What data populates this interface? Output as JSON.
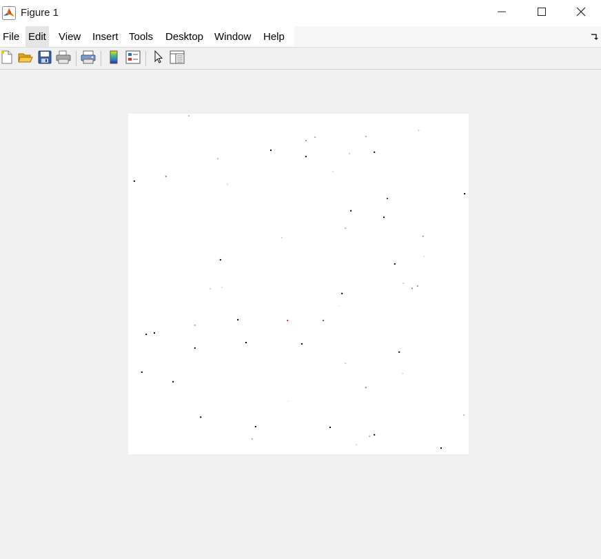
{
  "window": {
    "title": "Figure 1",
    "app_icon": "matlab-icon",
    "controls": [
      "minimize-icon",
      "maximize-icon",
      "close-icon"
    ]
  },
  "menu": {
    "items": [
      "File",
      "Edit",
      "View",
      "Insert",
      "Tools",
      "Desktop",
      "Window",
      "Help"
    ],
    "dock_icon": "dock-figure-icon"
  },
  "toolbar": {
    "buttons": [
      "new-figure-icon",
      "open-file-icon",
      "save-figure-icon",
      "print-figure-icon",
      "link-plot-icon",
      "insert-colorbar-icon",
      "insert-legend-icon",
      "edit-plot-icon",
      "open-property-inspector-icon"
    ]
  },
  "chart_data": {
    "type": "scatter",
    "xlim": [
      0,
      100
    ],
    "ylim": [
      0,
      100
    ],
    "grid": false,
    "axes_visible": false,
    "points": [
      {
        "x": 17.8,
        "y": 99.4,
        "shade": "#bbbbbb"
      },
      {
        "x": 52.2,
        "y": 92.1,
        "shade": "#999999"
      },
      {
        "x": 54.9,
        "y": 93.1,
        "shade": "#aaaaaa"
      },
      {
        "x": 69.8,
        "y": 93.3,
        "shade": "#aaaaaa"
      },
      {
        "x": 85.3,
        "y": 95.1,
        "shade": "#cccccc"
      },
      {
        "x": 41.9,
        "y": 89.3,
        "shade": "#000000"
      },
      {
        "x": 52.2,
        "y": 87.4,
        "shade": "#000000"
      },
      {
        "x": 26.3,
        "y": 86.8,
        "shade": "#bbbbbb"
      },
      {
        "x": 65.0,
        "y": 88.3,
        "shade": "#cccccc"
      },
      {
        "x": 72.3,
        "y": 88.7,
        "shade": "#000000"
      },
      {
        "x": 1.8,
        "y": 80.2,
        "shade": "#000000"
      },
      {
        "x": 11.1,
        "y": 81.6,
        "shade": "#888888"
      },
      {
        "x": 29.1,
        "y": 79.3,
        "shade": "#dddddd"
      },
      {
        "x": 60.1,
        "y": 83.0,
        "shade": "#dddddd"
      },
      {
        "x": 98.8,
        "y": 76.5,
        "shade": "#000000"
      },
      {
        "x": 76.1,
        "y": 75.1,
        "shade": "#444444"
      },
      {
        "x": 65.4,
        "y": 71.5,
        "shade": "#000000"
      },
      {
        "x": 75.1,
        "y": 69.6,
        "shade": "#000000"
      },
      {
        "x": 63.8,
        "y": 66.4,
        "shade": "#bbbbbb"
      },
      {
        "x": 45.1,
        "y": 63.6,
        "shade": "#cccccc"
      },
      {
        "x": 86.6,
        "y": 64.0,
        "shade": "#999999"
      },
      {
        "x": 27.1,
        "y": 57.1,
        "shade": "#000000"
      },
      {
        "x": 78.3,
        "y": 55.9,
        "shade": "#000000"
      },
      {
        "x": 86.9,
        "y": 58.1,
        "shade": "#dddddd"
      },
      {
        "x": 24.1,
        "y": 48.6,
        "shade": "#cccccc"
      },
      {
        "x": 27.5,
        "y": 49.0,
        "shade": "#dddddd"
      },
      {
        "x": 83.4,
        "y": 48.7,
        "shade": "#999999"
      },
      {
        "x": 80.8,
        "y": 50.2,
        "shade": "#cccccc"
      },
      {
        "x": 85.0,
        "y": 49.4,
        "shade": "#999999"
      },
      {
        "x": 62.8,
        "y": 47.2,
        "shade": "#000000"
      },
      {
        "x": 61.9,
        "y": 43.5,
        "shade": "#eeeeee"
      },
      {
        "x": 32.2,
        "y": 39.5,
        "shade": "#000000"
      },
      {
        "x": 46.8,
        "y": 39.3,
        "shade": "#cc3333"
      },
      {
        "x": 57.3,
        "y": 39.3,
        "shade": "#555555"
      },
      {
        "x": 19.6,
        "y": 37.9,
        "shade": "#aaaaaa"
      },
      {
        "x": 5.3,
        "y": 35.2,
        "shade": "#000000"
      },
      {
        "x": 7.7,
        "y": 35.6,
        "shade": "#000000"
      },
      {
        "x": 34.6,
        "y": 32.8,
        "shade": "#000000"
      },
      {
        "x": 51.0,
        "y": 32.4,
        "shade": "#000000"
      },
      {
        "x": 19.6,
        "y": 31.2,
        "shade": "#000000"
      },
      {
        "x": 79.6,
        "y": 30.0,
        "shade": "#000000"
      },
      {
        "x": 63.8,
        "y": 26.7,
        "shade": "#cccccc"
      },
      {
        "x": 4.0,
        "y": 24.1,
        "shade": "#000000"
      },
      {
        "x": 80.6,
        "y": 23.7,
        "shade": "#dddddd"
      },
      {
        "x": 13.2,
        "y": 21.3,
        "shade": "#000000"
      },
      {
        "x": 69.8,
        "y": 19.6,
        "shade": "#888888"
      },
      {
        "x": 47.0,
        "y": 15.6,
        "shade": "#eeeeee"
      },
      {
        "x": 98.6,
        "y": 11.5,
        "shade": "#bbbbbb"
      },
      {
        "x": 21.3,
        "y": 10.9,
        "shade": "#000000"
      },
      {
        "x": 37.4,
        "y": 8.1,
        "shade": "#000000"
      },
      {
        "x": 59.3,
        "y": 7.9,
        "shade": "#000000"
      },
      {
        "x": 36.4,
        "y": 4.5,
        "shade": "#aaaaaa"
      },
      {
        "x": 72.3,
        "y": 5.7,
        "shade": "#000000"
      },
      {
        "x": 70.9,
        "y": 5.3,
        "shade": "#aaaaaa"
      },
      {
        "x": 67.0,
        "y": 2.8,
        "shade": "#dddddd"
      },
      {
        "x": 91.9,
        "y": 1.8,
        "shade": "#000000"
      }
    ]
  }
}
